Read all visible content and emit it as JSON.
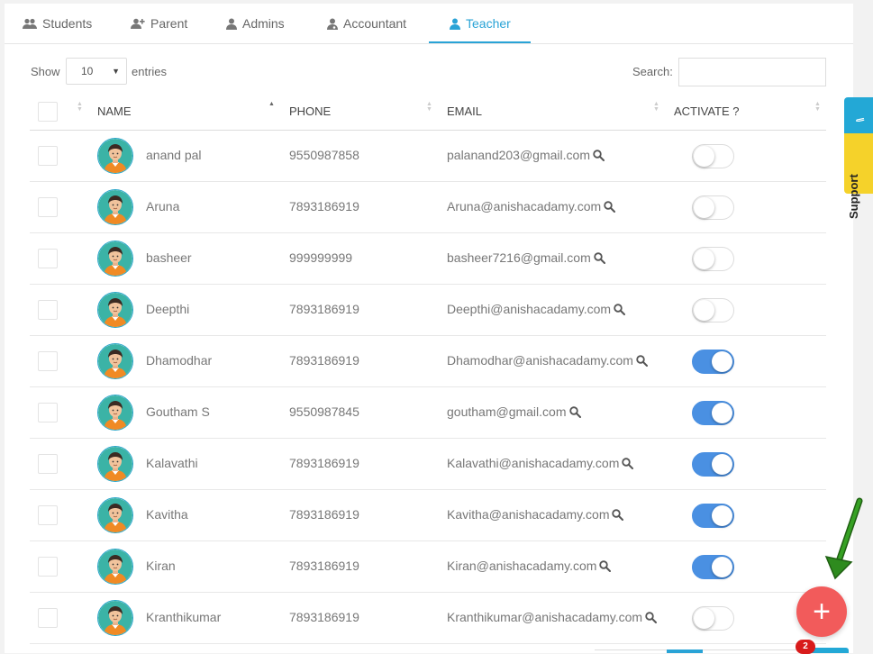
{
  "tabs": [
    {
      "label": "Students",
      "icon": "users-icon"
    },
    {
      "label": "Parent",
      "icon": "user-plus-icon"
    },
    {
      "label": "Admins",
      "icon": "user-icon"
    },
    {
      "label": "Accountant",
      "icon": "user-md-icon"
    },
    {
      "label": "Teacher",
      "icon": "user-icon",
      "active": true
    }
  ],
  "controls": {
    "show_label": "Show",
    "length_value": "10",
    "entries_label": "entries",
    "search_label": "Search:",
    "search_value": ""
  },
  "table": {
    "headers": {
      "name": "NAME",
      "phone": "PHONE",
      "email": "EMAIL",
      "activate": "ACTIVATE ?"
    },
    "rows": [
      {
        "name": "anand pal",
        "phone": "9550987858",
        "email": "palanand203@gmail.com",
        "active": false
      },
      {
        "name": "Aruna",
        "phone": "7893186919",
        "email": "Aruna@anishacadamy.com",
        "active": false
      },
      {
        "name": "basheer",
        "phone": "999999999",
        "email": "basheer7216@gmail.com",
        "active": false
      },
      {
        "name": "Deepthi",
        "phone": "7893186919",
        "email": "Deepthi@anishacadamy.com",
        "active": false
      },
      {
        "name": "Dhamodhar",
        "phone": "7893186919",
        "email": "Dhamodhar@anishacadamy.com",
        "active": true
      },
      {
        "name": "Goutham S",
        "phone": "9550987845",
        "email": "goutham@gmail.com",
        "active": true
      },
      {
        "name": "Kalavathi",
        "phone": "7893186919",
        "email": "Kalavathi@anishacadamy.com",
        "active": true
      },
      {
        "name": "Kavitha",
        "phone": "7893186919",
        "email": "Kavitha@anishacadamy.com",
        "active": true
      },
      {
        "name": "Kiran",
        "phone": "7893186919",
        "email": "Kiran@anishacadamy.com",
        "active": true
      },
      {
        "name": "Kranthikumar",
        "phone": "7893186919",
        "email": "Kranthikumar@anishacadamy.com",
        "active": false
      }
    ]
  },
  "support": {
    "label": "Support",
    "icon": "book-icon"
  },
  "fab": {
    "symbol": "+",
    "badge_count": "2"
  },
  "colors": {
    "accent": "#29a3d6",
    "toggle_on": "#4a90e2",
    "fab": "#f25b5b",
    "support_yellow": "#f5d22a",
    "arrow": "#2e8b1e"
  }
}
